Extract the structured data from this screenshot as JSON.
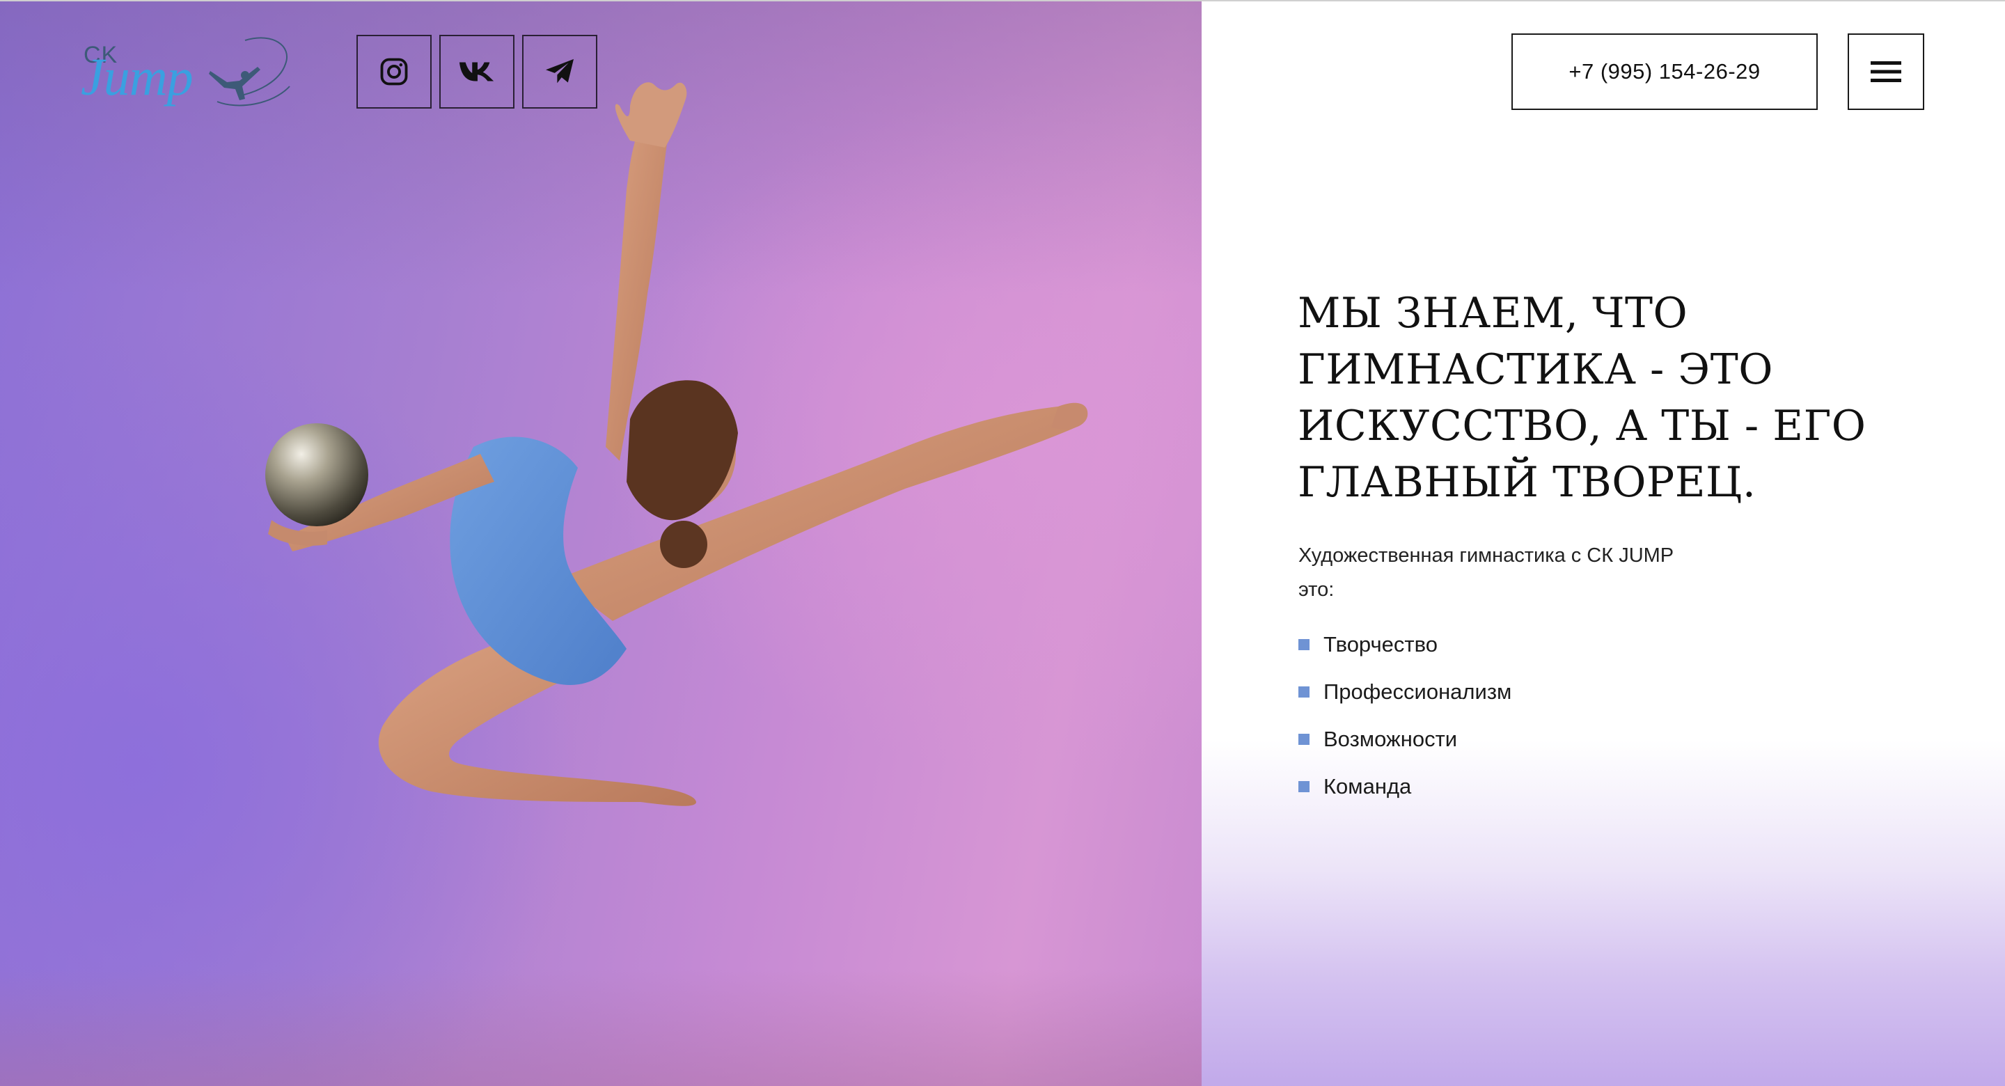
{
  "header": {
    "logo": {
      "prefix": "CK",
      "wordmark": "Jump"
    },
    "social_links": [
      {
        "icon": "instagram-icon"
      },
      {
        "icon": "vk-icon"
      },
      {
        "icon": "telegram-icon"
      }
    ],
    "phone": "+7 (995) 154-26-29",
    "menu_icon": "hamburger-menu-icon"
  },
  "hero": {
    "headline": "МЫ ЗНАЕМ, ЧТО\nГИМНАСТИКА - ЭТО\nИСКУССТВО, А ТЫ - ЕГО\nГЛАВНЫЙ ТВОРЕЦ.",
    "intro": "Художественная гимнастика с СК JUMP\nэто:",
    "features": [
      "Творчество",
      "Профессионализм",
      "Возможности",
      "Команда"
    ]
  },
  "colors": {
    "bullet": "#6f93d4",
    "hero_bg_left": "#8c70d6",
    "hero_bg_right": "#d796d4",
    "panel_bottom": "#c1a9ea"
  }
}
